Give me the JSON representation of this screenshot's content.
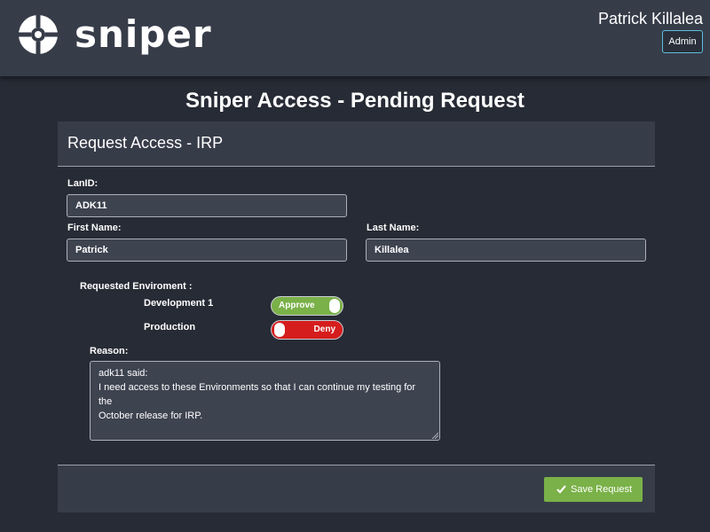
{
  "header": {
    "brand": "sniper",
    "user_name": "Patrick Killalea",
    "admin_label": "Admin"
  },
  "page": {
    "title": "Sniper Access - Pending Request"
  },
  "panel": {
    "title": "Request Access - IRP",
    "lanid_label": "LanID:",
    "lanid_value": "ADK11",
    "first_name_label": "First Name:",
    "first_name_value": "Patrick",
    "last_name_label": "Last Name:",
    "last_name_value": "Killalea",
    "environment_label": "Requested Enviroment :",
    "environments": [
      {
        "name": "Development 1",
        "decision": "Approve",
        "state": "on",
        "color": "#7ab148"
      },
      {
        "name": "Production",
        "decision": "Deny",
        "state": "off",
        "color": "#d51d1d"
      }
    ],
    "reason_label": "Reason:",
    "reason_lines": [
      "adk11 said:",
      "I need access to these Environments so that I can continue my testing for the",
      "October release for IRP."
    ],
    "save_label": "Save Request"
  },
  "colors": {
    "background": "#272b35",
    "header_background": "#373c49",
    "accent_green": "#7ab148",
    "accent_red": "#d51d1d",
    "admin_border": "#5bc0de"
  },
  "icons": {
    "logo": "crosshair-logo-icon",
    "save": "check-icon"
  }
}
